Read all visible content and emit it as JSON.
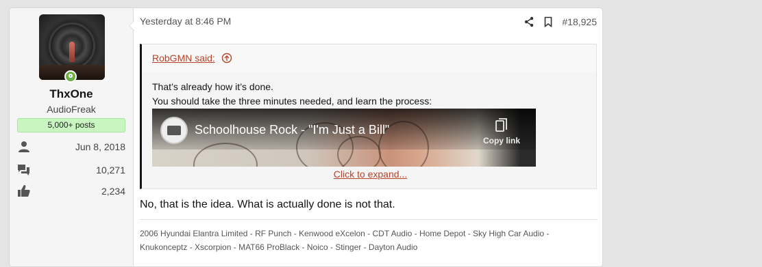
{
  "user": {
    "name": "ThxOne",
    "title": "AudioFreak",
    "badge": "5,000+ posts",
    "stats": [
      {
        "icon": "user-icon",
        "value": "Jun 8, 2018"
      },
      {
        "icon": "messages-icon",
        "value": "10,271"
      },
      {
        "icon": "thumbs-up-icon",
        "value": "2,234"
      }
    ]
  },
  "post": {
    "date": "Yesterday at 8:46 PM",
    "number": "#18,925",
    "quote": {
      "author": "RobGMN said:",
      "lines": [
        "That’s already how it’s done.",
        "You should take the three minutes needed, and learn the process:"
      ],
      "video": {
        "title": "Schoolhouse Rock - \"I'm Just a Bill\"",
        "copy_link": "Copy link"
      },
      "expand": "Click to expand..."
    },
    "reply": "No, that is the idea. What is actually done is not that.",
    "signature": "2006 Hyundai Elantra Limited - RF Punch - Kenwood eXcelon - CDT Audio - Home Depot - Sky High Car Audio - Knukonceptz - Xscorpion - MAT66 ProBlack - Noico - Stinger - Dayton Audio"
  }
}
